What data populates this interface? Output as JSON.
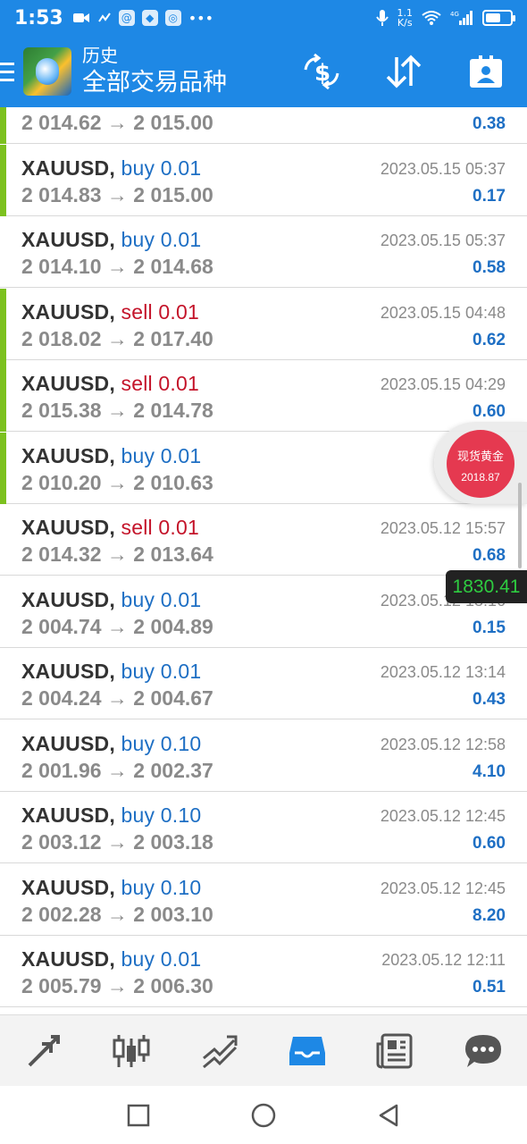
{
  "status_bar": {
    "time": "1:53",
    "network_speed": "1.1\nK/s",
    "network_type": "4G",
    "battery_level": 0.6
  },
  "header": {
    "subtitle": "历史",
    "title": "全部交易品种"
  },
  "trades": [
    {
      "symbol": "",
      "side": "",
      "volume": "",
      "prices": "2 014.62 → 2 015.00",
      "time": "",
      "profit": "0.38",
      "green_bar": true
    },
    {
      "symbol": "XAUUSD,",
      "side": "buy",
      "volume": "0.01",
      "prices": "2 014.83 → 2 015.00",
      "time": "2023.05.15 05:37",
      "profit": "0.17",
      "green_bar": true
    },
    {
      "symbol": "XAUUSD,",
      "side": "buy",
      "volume": "0.01",
      "prices": "2 014.10 → 2 014.68",
      "time": "2023.05.15 05:37",
      "profit": "0.58",
      "green_bar": false
    },
    {
      "symbol": "XAUUSD,",
      "side": "sell",
      "volume": "0.01",
      "prices": "2 018.02 → 2 017.40",
      "time": "2023.05.15 04:48",
      "profit": "0.62",
      "green_bar": true
    },
    {
      "symbol": "XAUUSD,",
      "side": "sell",
      "volume": "0.01",
      "prices": "2 015.38 → 2 014.78",
      "time": "2023.05.15 04:29",
      "profit": "0.60",
      "green_bar": true
    },
    {
      "symbol": "XAUUSD,",
      "side": "buy",
      "volume": "0.01",
      "prices": "2 010.20 → 2 010.63",
      "time": "2023.05",
      "profit": "",
      "green_bar": true
    },
    {
      "symbol": "XAUUSD,",
      "side": "sell",
      "volume": "0.01",
      "prices": "2 014.32 → 2 013.64",
      "time": "2023.05.12 15:57",
      "profit": "0.68",
      "green_bar": false
    },
    {
      "symbol": "XAUUSD,",
      "side": "buy",
      "volume": "0.01",
      "prices": "2 004.74 → 2 004.89",
      "time": "2023.05.12 13:16",
      "profit": "0.15",
      "green_bar": false
    },
    {
      "symbol": "XAUUSD,",
      "side": "buy",
      "volume": "0.01",
      "prices": "2 004.24 → 2 004.67",
      "time": "2023.05.12 13:14",
      "profit": "0.43",
      "green_bar": false
    },
    {
      "symbol": "XAUUSD,",
      "side": "buy",
      "volume": "0.10",
      "prices": "2 001.96 → 2 002.37",
      "time": "2023.05.12 12:58",
      "profit": "4.10",
      "green_bar": false
    },
    {
      "symbol": "XAUUSD,",
      "side": "buy",
      "volume": "0.10",
      "prices": "2 003.12 → 2 003.18",
      "time": "2023.05.12 12:45",
      "profit": "0.60",
      "green_bar": false
    },
    {
      "symbol": "XAUUSD,",
      "side": "buy",
      "volume": "0.10",
      "prices": "2 002.28 → 2 003.10",
      "time": "2023.05.12 12:45",
      "profit": "8.20",
      "green_bar": false
    },
    {
      "symbol": "XAUUSD,",
      "side": "buy",
      "volume": "0.01",
      "prices": "2 005.79 → 2 006.30",
      "time": "2023.05.12 12:11",
      "profit": "0.51",
      "green_bar": false
    }
  ],
  "floating_widget": {
    "name": "现货黄金",
    "price": "2018.87"
  },
  "price_chip": "1830.41",
  "colors": {
    "primary": "#1e88e5",
    "buy": "#1e6fc4",
    "sell": "#c4142a",
    "profit": "#1e6fc4",
    "green_bar": "#7cc11f",
    "widget_red": "#e53950"
  },
  "icons": {
    "toolbar": [
      "currency-exchange-icon",
      "sort-icon",
      "account-card-icon"
    ],
    "bottom_nav": [
      "trade-arrows-icon",
      "candlestick-chart-icon",
      "trend-line-icon",
      "history-inbox-icon",
      "news-icon",
      "chat-icon"
    ],
    "system_nav": [
      "recents-square-icon",
      "home-circle-icon",
      "back-triangle-icon"
    ]
  }
}
